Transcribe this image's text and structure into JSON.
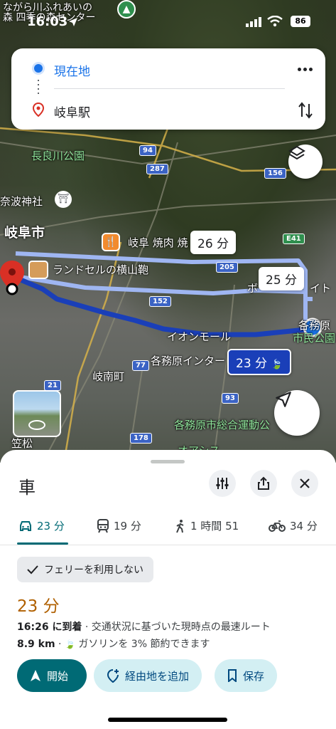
{
  "status": {
    "time": "16:03",
    "battery": "86"
  },
  "directions": {
    "origin": "現在地",
    "destination": "岐阜駅"
  },
  "map": {
    "labels": {
      "top_facility": "ながら川ふれあいの",
      "top_facility2": "森 四季の森センター",
      "park": "長良川公園",
      "shrine": "奈波神社",
      "city": "岐阜市",
      "restaurant": "岐阜 焼肉 焼",
      "bag_shop": "ランドセルの横山鞄",
      "aeon": "イオンモール",
      "interchange": "各務原インター",
      "ginan": "岐南町",
      "park2": "各務原市総合運動公",
      "kasamatsu": "笠松",
      "oasis": "オアシス",
      "kakamigahara": "各務原",
      "city_park": "市民公園",
      "partial_right": "ボ",
      "partial_right2": "イト"
    },
    "shields": {
      "r94": "94",
      "r287": "287",
      "r156": "156",
      "r205": "205",
      "r152": "152",
      "r77": "77",
      "r21": "21",
      "r93": "93",
      "r178": "178",
      "e41": "E41"
    },
    "route_times": {
      "alt1": "26 分",
      "alt2": "25 分",
      "selected": "23 分"
    }
  },
  "sheet": {
    "title": "車",
    "modes": [
      {
        "label": "23 分",
        "icon": "car-icon"
      },
      {
        "label": "19 分",
        "icon": "train-icon"
      },
      {
        "label": "1 時間 51",
        "icon": "walk-icon"
      },
      {
        "label": "34 分",
        "icon": "bike-icon"
      }
    ],
    "ferry_chip": "フェリーを利用しない",
    "duration": "23 分",
    "arrival_bold": "16:26 に到着",
    "arrival_desc": " · 交通状況に基づいた現時点の最速ルート",
    "distance_bold": "8.9 km",
    "eco_text": "ガソリンを 3% 節約できます",
    "start_button": "開始",
    "add_stop_button": "経由地を追加",
    "save_button": "保存"
  },
  "colors": {
    "accent": "#006a75",
    "route_selected": "#1a3fb8",
    "route_alt": "#9fb6f2",
    "duration": "#b06000"
  }
}
